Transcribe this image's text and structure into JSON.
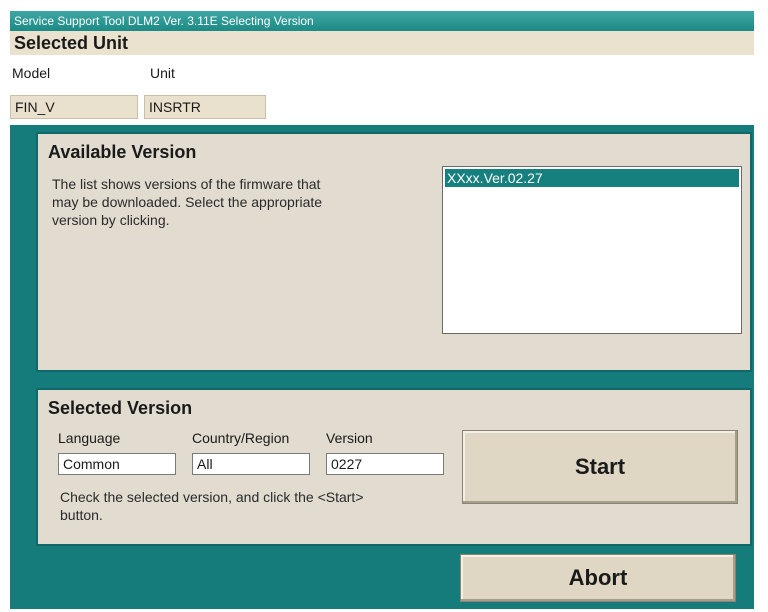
{
  "window": {
    "title": "Service Support Tool DLM2 Ver. 3.11E  Selecting Version"
  },
  "selected_unit": {
    "heading": "Selected Unit",
    "model_header": "Model",
    "unit_header": "Unit",
    "model_value": "FIN_V",
    "unit_value": "INSRTR"
  },
  "available_version": {
    "heading": "Available Version",
    "description_lines": [
      "The list shows versions of the firmware that",
      "may be downloaded. Select the appropriate",
      "version by clicking."
    ],
    "versions": [
      "XXxx.Ver.02.27"
    ]
  },
  "selected_version": {
    "heading": "Selected Version",
    "language_label": "Language",
    "language_value": "Common",
    "country_label": "Country/Region",
    "country_value": "All",
    "version_label": "Version",
    "version_value": "0227",
    "hint_lines": [
      "Check the selected version, and click the <Start>",
      "button."
    ]
  },
  "buttons": {
    "start_label": "Start",
    "abort_label": "Abort"
  },
  "colors": {
    "background_teal": "#167c7b",
    "panel": "#e1dccf",
    "list_selection": "#16807e"
  }
}
